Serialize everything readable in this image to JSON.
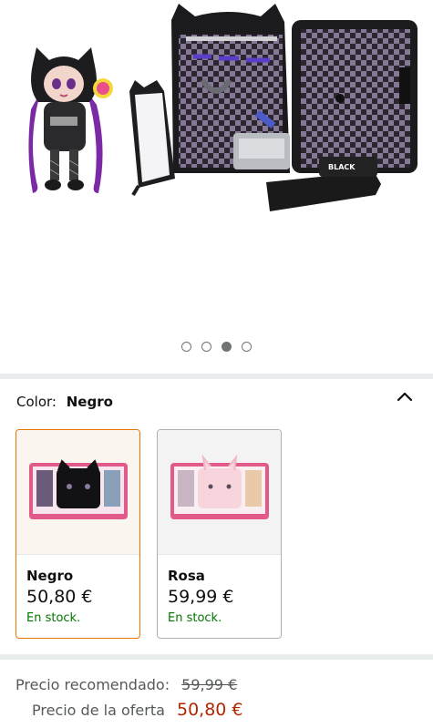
{
  "gallery": {
    "dot_count": 4,
    "active_index": 2,
    "images": [
      "doll-with-cat-hood",
      "suitcase-playset-open"
    ],
    "pillow_text": "BLACK"
  },
  "color": {
    "label": "Color:",
    "selected": "Negro"
  },
  "variants": [
    {
      "name": "Negro",
      "price": "50,80 €",
      "stock": "En stock.",
      "selected": true
    },
    {
      "name": "Rosa",
      "price": "59,99 €",
      "stock": "En stock.",
      "selected": false
    }
  ],
  "pricing": {
    "recommended_label": "Precio recomendado:",
    "recommended_value": "59,99 €",
    "offer_label": "Precio de la oferta",
    "offer_value": "50,80 €"
  },
  "colors": {
    "accent_border": "#e77600",
    "in_stock": "#007600",
    "deal_price": "#b12704"
  }
}
